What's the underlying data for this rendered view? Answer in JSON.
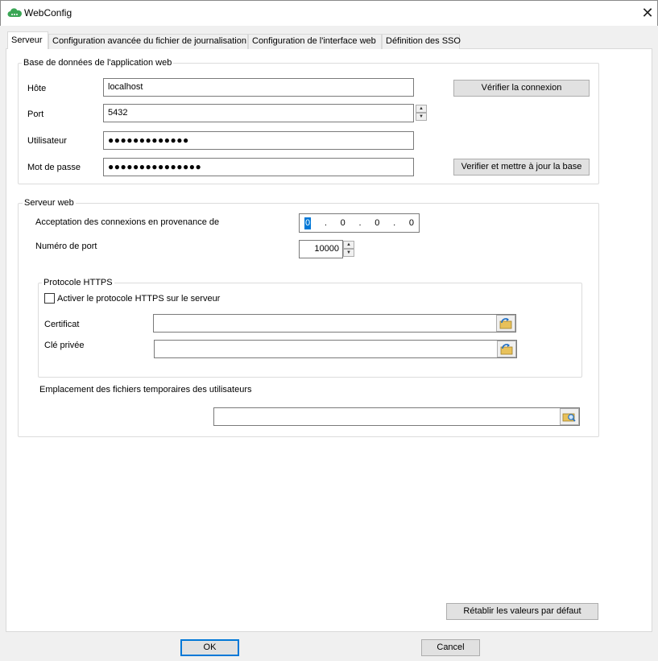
{
  "window": {
    "title": "WebConfig",
    "close_label": "✕"
  },
  "tabs": [
    {
      "label": "Serveur"
    },
    {
      "label": "Configuration avancée du fichier de journalisation"
    },
    {
      "label": "Configuration de l'interface web"
    },
    {
      "label": "Définition des SSO"
    }
  ],
  "database": {
    "legend": "Base de données de l'application web",
    "host_label": "Hôte",
    "host_value": "localhost",
    "port_label": "Port",
    "port_value": "5432",
    "user_label": "Utilisateur",
    "user_value": "●●●●●●●●●●●●●",
    "password_label": "Mot de passe",
    "password_value": "●●●●●●●●●●●●●●●",
    "check_button": "Vérifier la connexion",
    "update_button": "Verifier et mettre à jour la base"
  },
  "webserver": {
    "legend": "Serveur web",
    "accept_label": "Acceptation des connexions en provenance de",
    "ip": [
      "0",
      "0",
      "0",
      "0"
    ],
    "ip_sep": ".",
    "port_label": "Numéro de port",
    "port_value": "10000",
    "https": {
      "legend": "Protocole HTTPS",
      "enable_label": "Activer le protocole HTTPS sur le serveur",
      "enabled": false,
      "cert_label": "Certificat",
      "cert_value": "",
      "key_label": "Clé privée",
      "key_value": ""
    },
    "temp_label": "Emplacement des fichiers temporaires des utilisateurs",
    "temp_value": ""
  },
  "buttons": {
    "reset": "Rétablir les valeurs par défaut",
    "ok": "OK",
    "cancel": "Cancel"
  },
  "colors": {
    "accent": "#0078d7",
    "icon_green": "#3aa655",
    "folder_yellow": "#e8c15a"
  }
}
